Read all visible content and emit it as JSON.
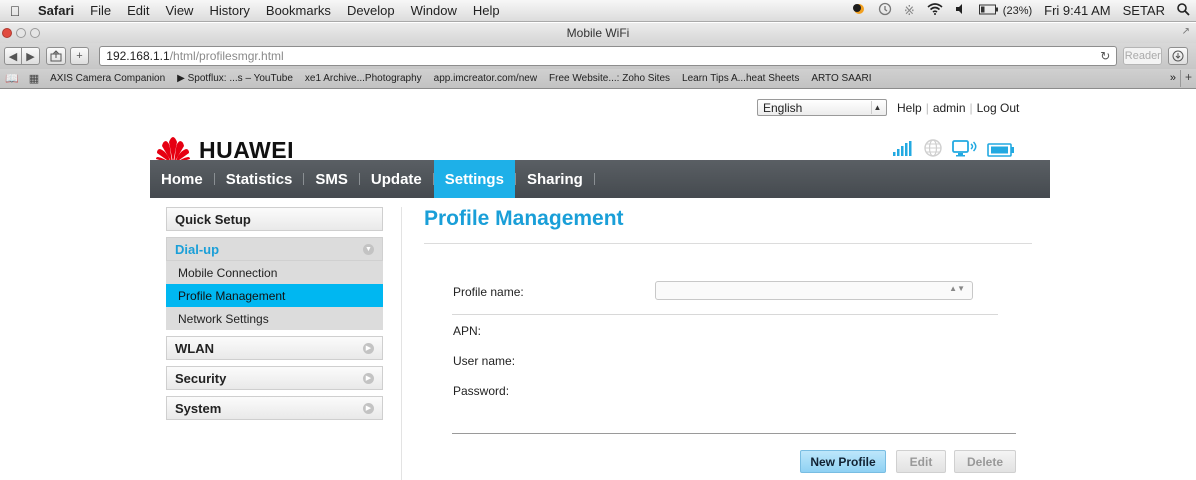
{
  "menubar": {
    "app": "Safari",
    "items": [
      "File",
      "Edit",
      "View",
      "History",
      "Bookmarks",
      "Develop",
      "Window",
      "Help"
    ],
    "battery": "(23%)",
    "clock": "Fri 9:41 AM",
    "user": "SETAR"
  },
  "window": {
    "title": "Mobile WiFi"
  },
  "toolbar": {
    "url_host": "192.168.1.1",
    "url_path": "/html/profilesmgr.html",
    "reader_label": "Reader"
  },
  "bookmarks": [
    "AXIS Camera Companion",
    "▶ Spotflux: ...s – YouTube",
    "xe1 Archive...Photography",
    "app.imcreator.com/new",
    "Free Website...: Zoho Sites",
    "Learn Tips A...heat Sheets",
    "ARTO SAARI"
  ],
  "util": {
    "language": "English",
    "help": "Help",
    "admin": "admin",
    "logout": "Log Out"
  },
  "brand": {
    "name": "HUAWEI",
    "color": "#e60012"
  },
  "nav": {
    "items": [
      "Home",
      "Statistics",
      "SMS",
      "Update",
      "Settings",
      "Sharing"
    ],
    "active": "Settings",
    "active_color": "#1eb0e8"
  },
  "sidebar": {
    "quick_setup": "Quick Setup",
    "dialup": "Dial-up",
    "dialup_items": [
      "Mobile Connection",
      "Profile Management",
      "Network Settings"
    ],
    "active_item": "Profile Management",
    "wlan": "WLAN",
    "security": "Security",
    "system": "System"
  },
  "content": {
    "title": "Profile Management",
    "profile_name_label": "Profile name:",
    "profile_name_value": "",
    "apn_label": "APN:",
    "username_label": "User name:",
    "password_label": "Password:",
    "new_profile": "New Profile",
    "edit": "Edit",
    "delete": "Delete"
  }
}
